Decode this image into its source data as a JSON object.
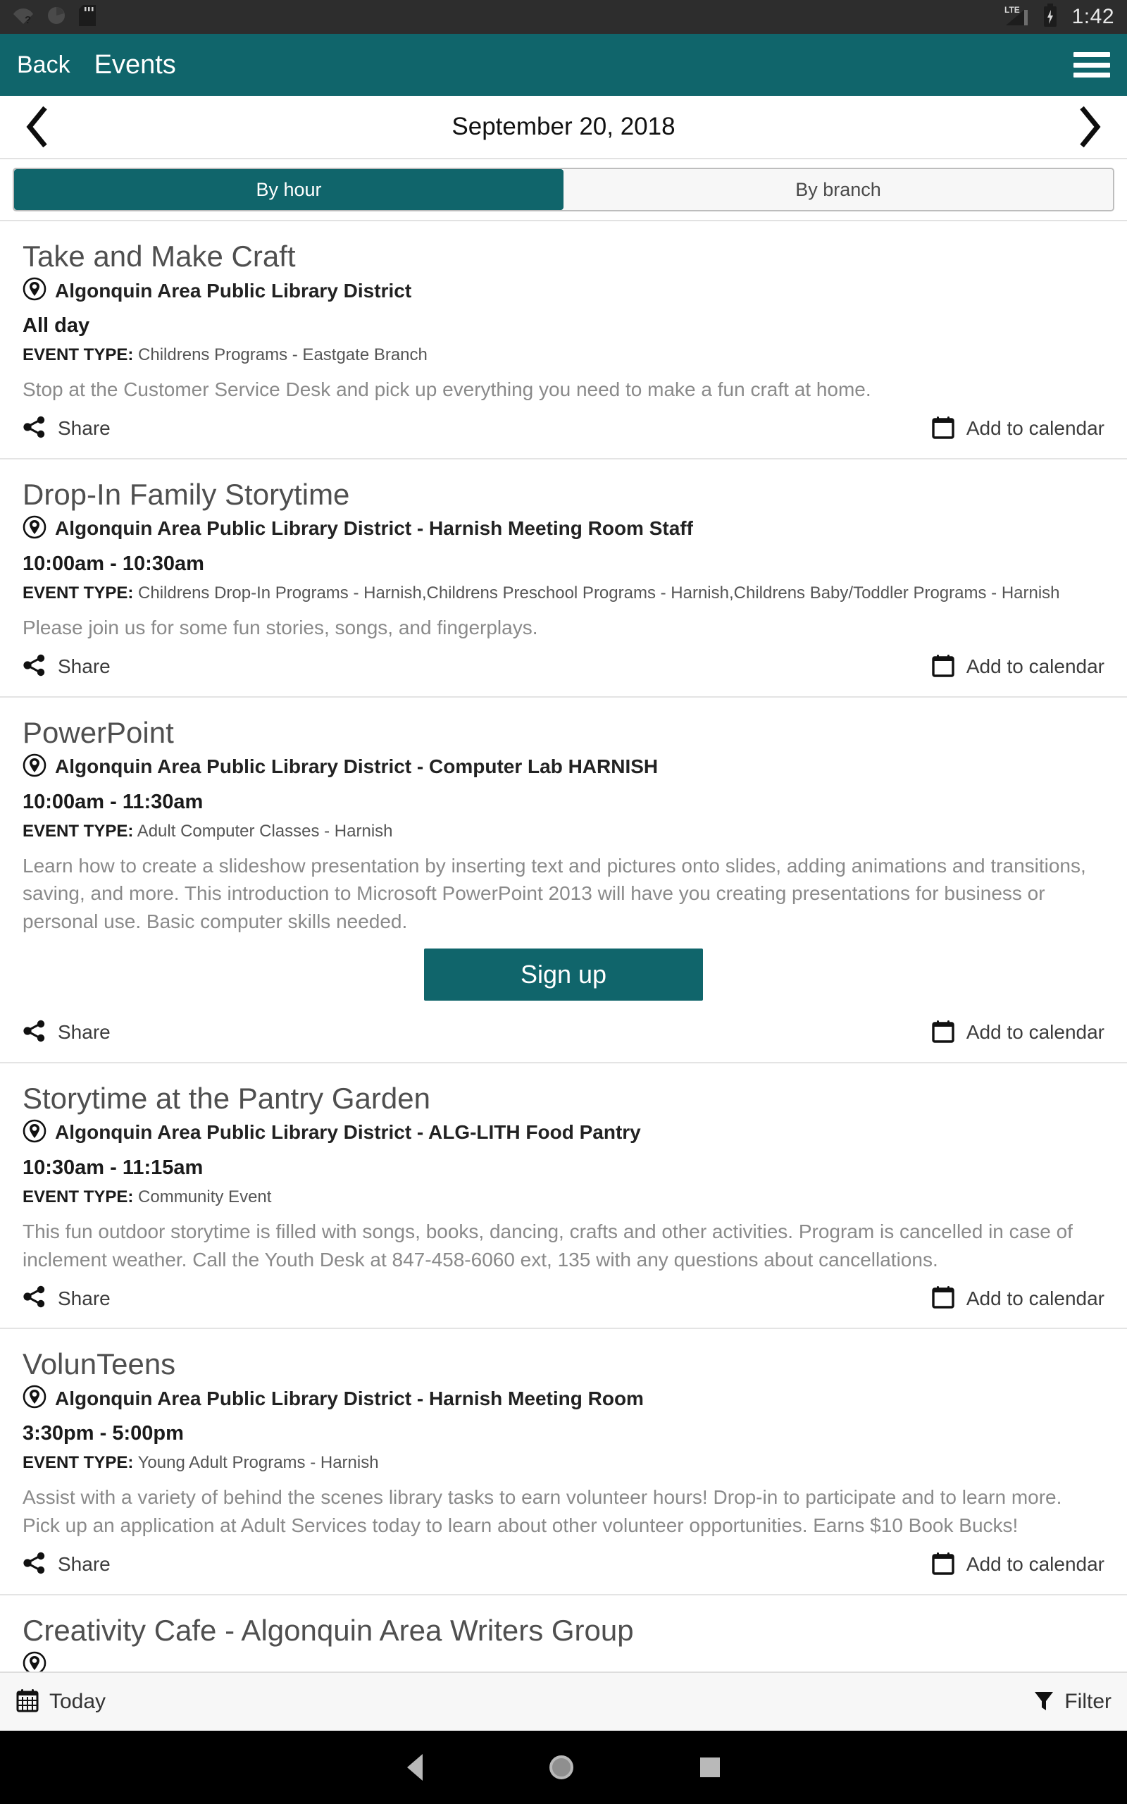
{
  "statusbar": {
    "icons_left": [
      "wifi-question-icon",
      "circle-pie-icon",
      "sd-card-icon"
    ],
    "network": "LTE",
    "icons_right": [
      "lte-signal-icon",
      "battery-charging-icon"
    ],
    "time": "1:42"
  },
  "appbar": {
    "back_label": "Back",
    "title": "Events",
    "menu_icon": "hamburger-menu-icon"
  },
  "datenav": {
    "prev_icon": "chevron-left-icon",
    "next_icon": "chevron-right-icon",
    "date": "September 20, 2018"
  },
  "tabs": [
    {
      "label": "By hour",
      "active": true
    },
    {
      "label": "By branch",
      "active": false
    }
  ],
  "labels": {
    "event_type_prefix": "EVENT TYPE:",
    "share": "Share",
    "add_to_calendar": "Add to calendar",
    "sign_up": "Sign up"
  },
  "events": [
    {
      "title": "Take and Make Craft",
      "location": "Algonquin Area Public Library District",
      "time": "All day",
      "event_type": "Childrens Programs - Eastgate Branch",
      "description": "Stop at the Customer Service Desk and pick up everything you need to make a fun craft at home.",
      "has_signup": false
    },
    {
      "title": "Drop-In Family Storytime",
      "location": "Algonquin Area Public Library District - Harnish Meeting Room Staff",
      "time": "10:00am - 10:30am",
      "event_type": "Childrens Drop-In Programs - Harnish,Childrens Preschool Programs - Harnish,Childrens Baby/Toddler Programs - Harnish",
      "description": "Please join us for some fun stories, songs, and fingerplays.",
      "has_signup": false
    },
    {
      "title": "PowerPoint",
      "location": "Algonquin Area Public Library District - Computer Lab HARNISH",
      "time": "10:00am - 11:30am",
      "event_type": "Adult Computer Classes - Harnish",
      "description": "Learn how to create a slideshow presentation by inserting text and pictures onto slides, adding animations and transitions, saving, and more. This introduction to Microsoft PowerPoint 2013 will have you creating presentations for business or personal use. Basic computer skills needed.",
      "has_signup": true
    },
    {
      "title": "Storytime at the Pantry Garden",
      "location": "Algonquin Area Public Library District - ALG-LITH Food Pantry",
      "time": "10:30am - 11:15am",
      "event_type": "Community Event",
      "description": "This fun outdoor storytime is filled with songs, books, dancing, crafts and other activities. Program is cancelled in case of inclement weather. Call the Youth Desk at 847-458-6060 ext, 135 with any questions about cancellations.",
      "has_signup": false
    },
    {
      "title": "VolunTeens",
      "location": "Algonquin Area Public Library District - Harnish Meeting Room",
      "time": "3:30pm - 5:00pm",
      "event_type": "Young Adult Programs - Harnish",
      "description": "Assist with a variety of behind the scenes library tasks to earn volunteer hours! Drop-in to participate and to learn more. Pick up an application at Adult Services today to learn about other volunteer opportunities. Earns $10 Book Bucks!",
      "has_signup": false
    }
  ],
  "partial_event": {
    "title": "Creativity Cafe - Algonquin Area Writers Group"
  },
  "bottombar": {
    "today_label": "Today",
    "today_icon": "calendar-grid-icon",
    "filter_label": "Filter",
    "filter_icon": "funnel-filter-icon"
  },
  "navbar": {
    "back_icon": "nav-back-triangle-icon",
    "home_icon": "nav-home-circle-icon",
    "recent_icon": "nav-recent-square-icon"
  },
  "colors": {
    "accent_teal": "#10656b",
    "statusbar_bg": "#2d2d2d",
    "navbar_bg": "#000000"
  }
}
